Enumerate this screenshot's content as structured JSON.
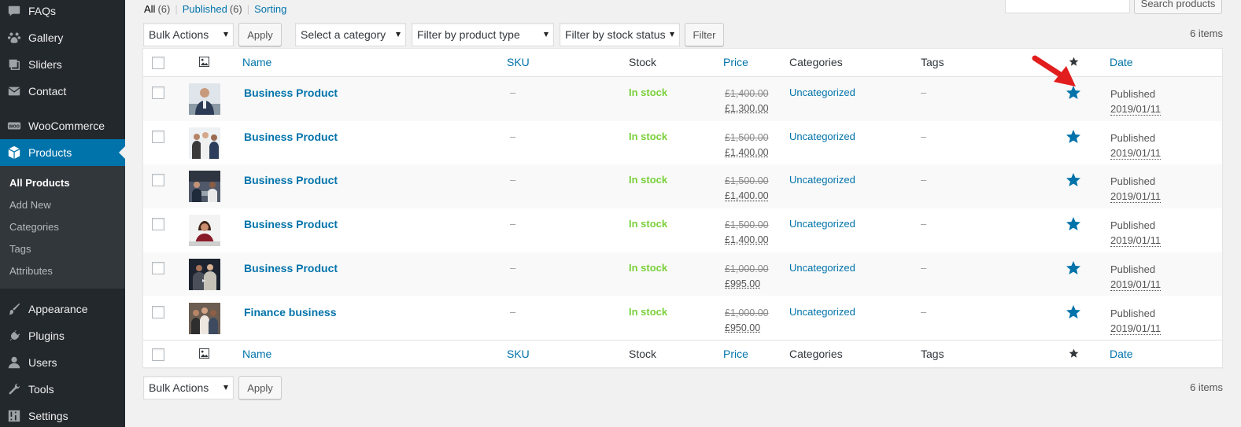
{
  "sidebar": {
    "top_items": [
      {
        "label": "FAQs",
        "icon": "speech-bubble-icon"
      },
      {
        "label": "Gallery",
        "icon": "paw-icon"
      },
      {
        "label": "Sliders",
        "icon": "slides-icon"
      },
      {
        "label": "Contact",
        "icon": "envelope-icon"
      },
      {
        "label": "WooCommerce",
        "icon": "woocommerce-icon"
      },
      {
        "label": "Products",
        "icon": "box-icon"
      }
    ],
    "submenu": [
      "All Products",
      "Add New",
      "Categories",
      "Tags",
      "Attributes"
    ],
    "bottom_items": [
      {
        "label": "Appearance",
        "icon": "paintbrush-icon"
      },
      {
        "label": "Plugins",
        "icon": "plugin-icon"
      },
      {
        "label": "Users",
        "icon": "users-icon"
      },
      {
        "label": "Tools",
        "icon": "wrench-icon"
      },
      {
        "label": "Settings",
        "icon": "settings-icon"
      }
    ],
    "woo_badge": "WOO"
  },
  "views": {
    "all_label": "All",
    "all_count": "(6)",
    "published_label": "Published",
    "published_count": "(6)",
    "sorting_label": "Sorting",
    "separator": "|"
  },
  "search": {
    "button_label": "Search products",
    "value": ""
  },
  "filters": {
    "bulk_actions": "Bulk Actions",
    "apply": "Apply",
    "category": "Select a category",
    "product_type": "Filter by product type",
    "stock_status": "Filter by stock status",
    "filter_button": "Filter"
  },
  "items_count": "6 items",
  "table": {
    "columns": {
      "name": "Name",
      "sku": "SKU",
      "stock": "Stock",
      "price": "Price",
      "categories": "Categories",
      "tags": "Tags",
      "date": "Date"
    },
    "rows": [
      {
        "name": "Business Product",
        "sku": "–",
        "stock": "In stock",
        "old_price": "£1,400.00",
        "new_price": "£1,300.00",
        "category": "Uncategorized",
        "tags": "–",
        "status": "Published",
        "date": "2019/01/11"
      },
      {
        "name": "Business Product",
        "sku": "–",
        "stock": "In stock",
        "old_price": "£1,500.00",
        "new_price": "£1,400.00",
        "category": "Uncategorized",
        "tags": "–",
        "status": "Published",
        "date": "2019/01/11"
      },
      {
        "name": "Business Product",
        "sku": "–",
        "stock": "In stock",
        "old_price": "£1,500.00",
        "new_price": "£1,400.00",
        "category": "Uncategorized",
        "tags": "–",
        "status": "Published",
        "date": "2019/01/11"
      },
      {
        "name": "Business Product",
        "sku": "–",
        "stock": "In stock",
        "old_price": "£1,500.00",
        "new_price": "£1,400.00",
        "category": "Uncategorized",
        "tags": "–",
        "status": "Published",
        "date": "2019/01/11"
      },
      {
        "name": "Business Product",
        "sku": "–",
        "stock": "In stock",
        "old_price": "£1,000.00",
        "new_price": "£995.00",
        "category": "Uncategorized",
        "tags": "–",
        "status": "Published",
        "date": "2019/01/11"
      },
      {
        "name": "Finance business",
        "sku": "–",
        "stock": "In stock",
        "old_price": "£1,000.00",
        "new_price": "£950.00",
        "category": "Uncategorized",
        "tags": "–",
        "status": "Published",
        "date": "2019/01/11"
      }
    ]
  },
  "colors": {
    "admin_bar": "#23282d",
    "submenu_bg": "#32373c",
    "accent": "#0073aa",
    "in_stock": "#7ad03a",
    "annotation_arrow": "#e21d1d"
  }
}
